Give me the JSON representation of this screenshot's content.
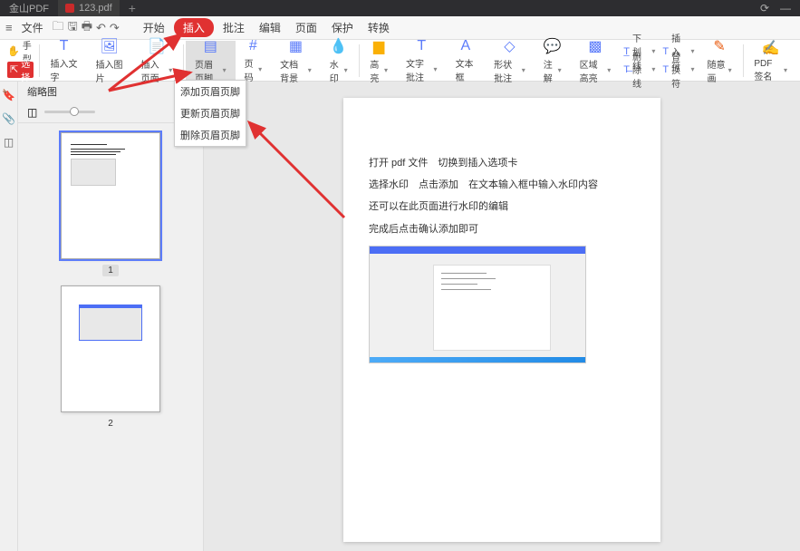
{
  "app": {
    "name": "金山PDF"
  },
  "tabs": [
    {
      "filename": "123.pdf"
    }
  ],
  "menu": {
    "file": "文件",
    "items": [
      "开始",
      "插入",
      "批注",
      "编辑",
      "页面",
      "保护",
      "转换"
    ],
    "active_index": 1
  },
  "ribbon": {
    "hand": "手型",
    "select": "选择",
    "insert_text": "插入文字",
    "insert_image": "插入图片",
    "insert_page": "插入页面",
    "header_footer": "页眉页脚",
    "page_number": "页码",
    "background": "文档背景",
    "watermark": "水印",
    "highlight": "高亮",
    "text_annotate": "文字批注",
    "textbox": "文本框",
    "shape_annotate": "形状批注",
    "annotate": "注解",
    "area_highlight": "区域高亮",
    "underline": "下划线",
    "delete_line": "删除线",
    "insert_char": "插入符",
    "replace_char": "替换符",
    "freehand": "随意画",
    "pdf_sign": "PDF 签名"
  },
  "dropdown": {
    "items": [
      "添加页眉页脚",
      "更新页眉页脚",
      "删除页眉页脚"
    ]
  },
  "thumbs": {
    "title": "缩略图",
    "pages": [
      1,
      2
    ]
  },
  "document": {
    "p1": "打开 pdf 文件　切换到插入选项卡",
    "p2": "选择水印　点击添加　在文本输入框中输入水印内容",
    "p3": "还可以在此页面进行水印的编辑",
    "p4": "完成后点击确认添加即可"
  }
}
